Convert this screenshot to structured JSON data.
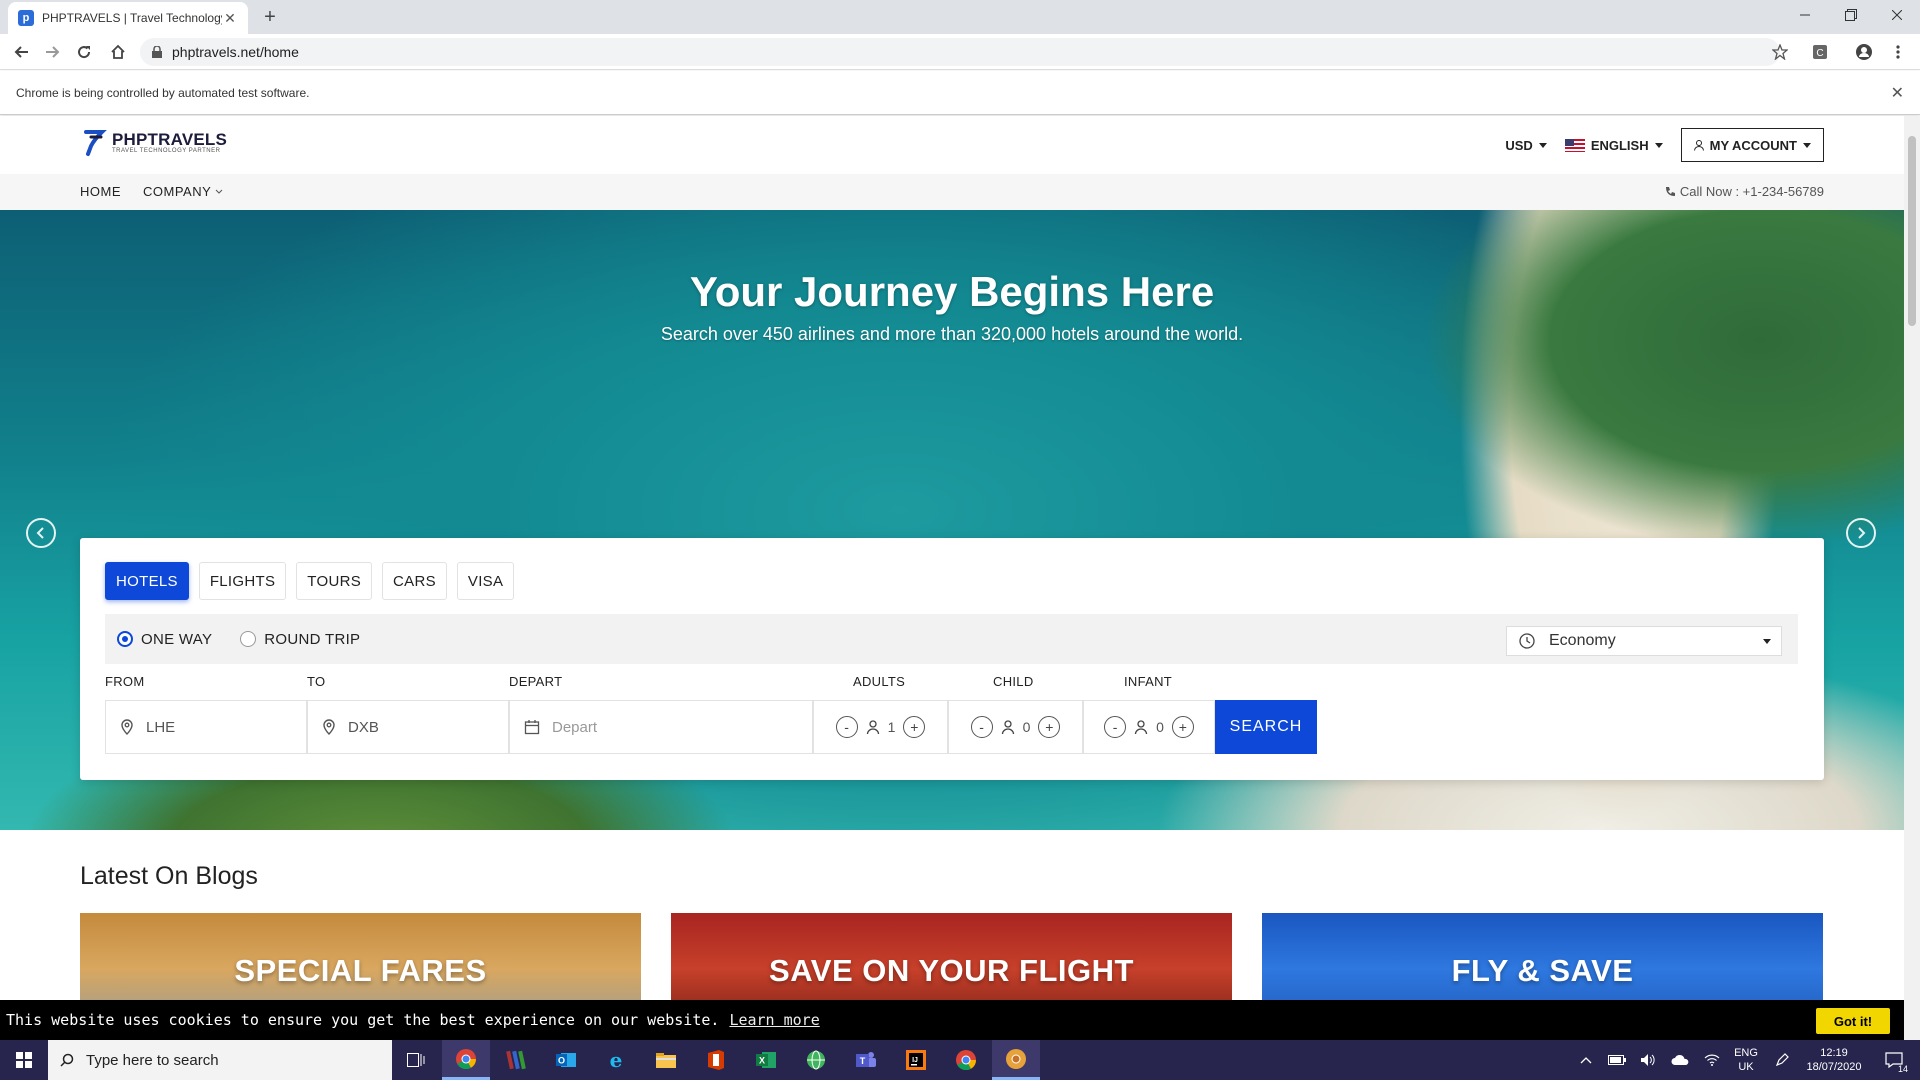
{
  "browser": {
    "tab_title": "PHPTRAVELS | Travel Technology",
    "tab_favicon": "p",
    "url": "phptravels.net/home",
    "infobar_text": "Chrome is being controlled by automated test software."
  },
  "site": {
    "logo_text": "PHPTRAVELS",
    "logo_tagline": "TRAVEL TECHNOLOGY PARTNER",
    "currency": "USD",
    "language": "ENGLISH",
    "account": "MY ACCOUNT",
    "menu": [
      {
        "label": "HOME"
      },
      {
        "label": "COMPANY"
      }
    ],
    "call_now": "Call Now : +1-234-56789"
  },
  "hero": {
    "title": "Your Journey Begins Here",
    "subtitle": "Search over 450 airlines and more than 320,000 hotels around the world."
  },
  "search": {
    "tabs": [
      {
        "label": "HOTELS",
        "active": true
      },
      {
        "label": "FLIGHTS",
        "active": false
      },
      {
        "label": "TOURS",
        "active": false
      },
      {
        "label": "CARS",
        "active": false
      },
      {
        "label": "VISA",
        "active": false
      }
    ],
    "trip_types": [
      {
        "label": "ONE WAY",
        "selected": true
      },
      {
        "label": "ROUND TRIP",
        "selected": false
      }
    ],
    "cabin_class": "Economy",
    "labels": {
      "from": "FROM",
      "to": "TO",
      "depart": "DEPART",
      "adults": "ADULTS",
      "child": "CHILD",
      "infant": "INFANT"
    },
    "from_value": "LHE",
    "to_value": "DXB",
    "depart_placeholder": "Depart",
    "adults_count": "1",
    "child_count": "0",
    "infant_count": "0",
    "minus": "-",
    "plus": "+",
    "search_button": "SEARCH"
  },
  "blogs": {
    "heading": "Latest On Blogs",
    "cards": [
      {
        "title": "SPECIAL FARES",
        "color": "#d99a3a"
      },
      {
        "title": "SAVE ON YOUR FLIGHT",
        "color": "#b52a23"
      },
      {
        "title": "FLY & SAVE",
        "color": "#1f5fc4"
      }
    ]
  },
  "cookie": {
    "message": "This website uses cookies to ensure you get the best experience on our website.",
    "learn_more": "Learn more",
    "accept": "Got it!"
  },
  "taskbar": {
    "search_placeholder": "Type here to search",
    "lang_line1": "ENG",
    "lang_line2": "UK",
    "time": "12:19",
    "date": "18/07/2020",
    "notifications": "14"
  },
  "colors": {
    "primary": "#0d48d8",
    "cookie_button": "#f1d600",
    "taskbar": "#27254d"
  }
}
